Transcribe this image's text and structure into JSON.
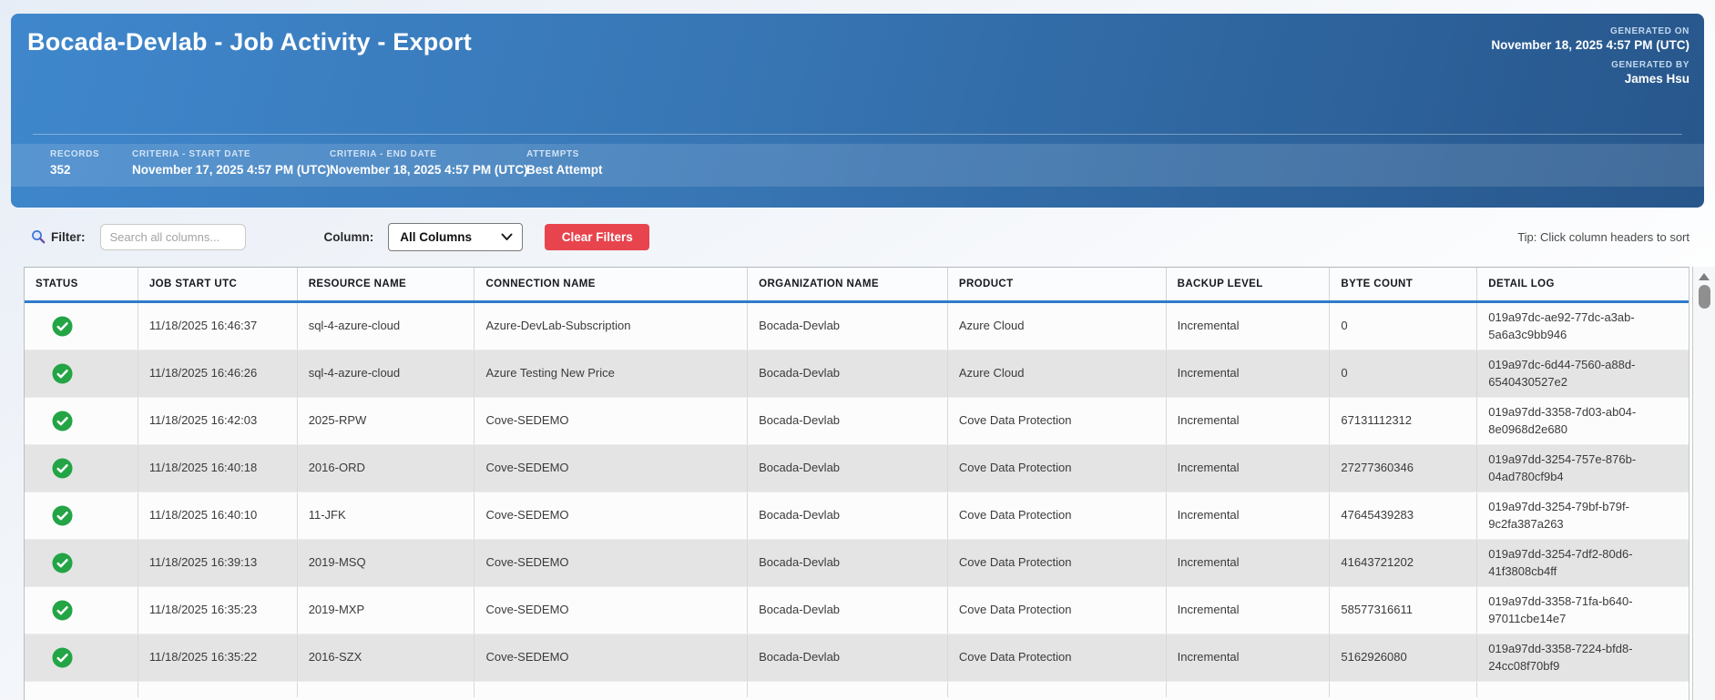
{
  "header": {
    "title": "Bocada-Devlab - Job Activity - Export",
    "generated_on_label": "GENERATED ON",
    "generated_on": "November 18, 2025 4:57 PM (UTC)",
    "generated_by_label": "GENERATED BY",
    "generated_by": "James Hsu",
    "criteria": [
      {
        "label": "RECORDS",
        "value": "352"
      },
      {
        "label": "CRITERIA - START DATE",
        "value": "November 17, 2025 4:57 PM (UTC)"
      },
      {
        "label": "CRITERIA - END DATE",
        "value": "November 18, 2025 4:57 PM (UTC)"
      },
      {
        "label": "ATTEMPTS",
        "value": "Best Attempt"
      }
    ]
  },
  "filter_bar": {
    "filter_label": "Filter:",
    "search_placeholder": "Search all columns...",
    "search_value": "",
    "column_label": "Column:",
    "column_selected": "All Columns",
    "clear_button": "Clear Filters",
    "tip": "Tip: Click column headers to sort"
  },
  "table": {
    "columns": [
      "STATUS",
      "JOB START UTC",
      "RESOURCE NAME",
      "CONNECTION NAME",
      "ORGANIZATION NAME",
      "PRODUCT",
      "BACKUP LEVEL",
      "BYTE COUNT",
      "DETAIL LOG"
    ],
    "status_icon": "success-check-icon",
    "rows": [
      {
        "status": "success",
        "job_start_utc": "11/18/2025 16:46:37",
        "resource_name": "sql-4-azure-cloud",
        "connection_name": "Azure-DevLab-Subscription",
        "organization_name": "Bocada-Devlab",
        "product": "Azure Cloud",
        "backup_level": "Incremental",
        "byte_count": "0",
        "detail_log": "019a97dc-ae92-77dc-a3ab-5a6a3c9bb946"
      },
      {
        "status": "success",
        "job_start_utc": "11/18/2025 16:46:26",
        "resource_name": "sql-4-azure-cloud",
        "connection_name": "Azure Testing New Price",
        "organization_name": "Bocada-Devlab",
        "product": "Azure Cloud",
        "backup_level": "Incremental",
        "byte_count": "0",
        "detail_log": "019a97dc-6d44-7560-a88d-6540430527e2"
      },
      {
        "status": "success",
        "job_start_utc": "11/18/2025 16:42:03",
        "resource_name": "2025-RPW",
        "connection_name": "Cove-SEDEMO",
        "organization_name": "Bocada-Devlab",
        "product": "Cove Data Protection",
        "backup_level": "Incremental",
        "byte_count": "67131112312",
        "detail_log": "019a97dd-3358-7d03-ab04-8e0968d2e680"
      },
      {
        "status": "success",
        "job_start_utc": "11/18/2025 16:40:18",
        "resource_name": "2016-ORD",
        "connection_name": "Cove-SEDEMO",
        "organization_name": "Bocada-Devlab",
        "product": "Cove Data Protection",
        "backup_level": "Incremental",
        "byte_count": "27277360346",
        "detail_log": "019a97dd-3254-757e-876b-04ad780cf9b4"
      },
      {
        "status": "success",
        "job_start_utc": "11/18/2025 16:40:10",
        "resource_name": "11-JFK",
        "connection_name": "Cove-SEDEMO",
        "organization_name": "Bocada-Devlab",
        "product": "Cove Data Protection",
        "backup_level": "Incremental",
        "byte_count": "47645439283",
        "detail_log": "019a97dd-3254-79bf-b79f-9c2fa387a263"
      },
      {
        "status": "success",
        "job_start_utc": "11/18/2025 16:39:13",
        "resource_name": "2019-MSQ",
        "connection_name": "Cove-SEDEMO",
        "organization_name": "Bocada-Devlab",
        "product": "Cove Data Protection",
        "backup_level": "Incremental",
        "byte_count": "41643721202",
        "detail_log": "019a97dd-3254-7df2-80d6-41f3808cb4ff"
      },
      {
        "status": "success",
        "job_start_utc": "11/18/2025 16:35:23",
        "resource_name": "2019-MXP",
        "connection_name": "Cove-SEDEMO",
        "organization_name": "Bocada-Devlab",
        "product": "Cove Data Protection",
        "backup_level": "Incremental",
        "byte_count": "58577316611",
        "detail_log": "019a97dd-3358-71fa-b640-97011cbe14e7"
      },
      {
        "status": "success",
        "job_start_utc": "11/18/2025 16:35:22",
        "resource_name": "2016-SZX",
        "connection_name": "Cove-SEDEMO",
        "organization_name": "Bocada-Devlab",
        "product": "Cove Data Protection",
        "backup_level": "Incremental",
        "byte_count": "5162926080",
        "detail_log": "019a97dd-3358-7224-bfd8-24cc08f70bf9"
      }
    ]
  },
  "colors": {
    "header_gradient_start": "#3f87cc",
    "header_gradient_end": "#27568b",
    "accent_blue": "#2e7cc9",
    "success_green": "#23a445",
    "clear_button_red": "#e8444e",
    "stripe_gray": "#e4e4e4"
  }
}
